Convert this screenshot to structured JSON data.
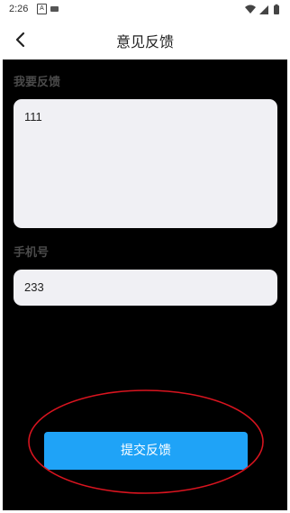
{
  "status_bar": {
    "time": "2:26",
    "indicator_letter": "A"
  },
  "toolbar": {
    "title": "意见反馈",
    "back_icon": "chevron-left-icon"
  },
  "feedback": {
    "label": "我要反馈",
    "value": "111"
  },
  "phone": {
    "label": "手机号",
    "value": "233"
  },
  "submit": {
    "label": "提交反馈"
  },
  "colors": {
    "accent": "#1fa3f7",
    "content_background": "#000000",
    "field_background": "#f0f0f4",
    "highlight": "#d9141f"
  }
}
